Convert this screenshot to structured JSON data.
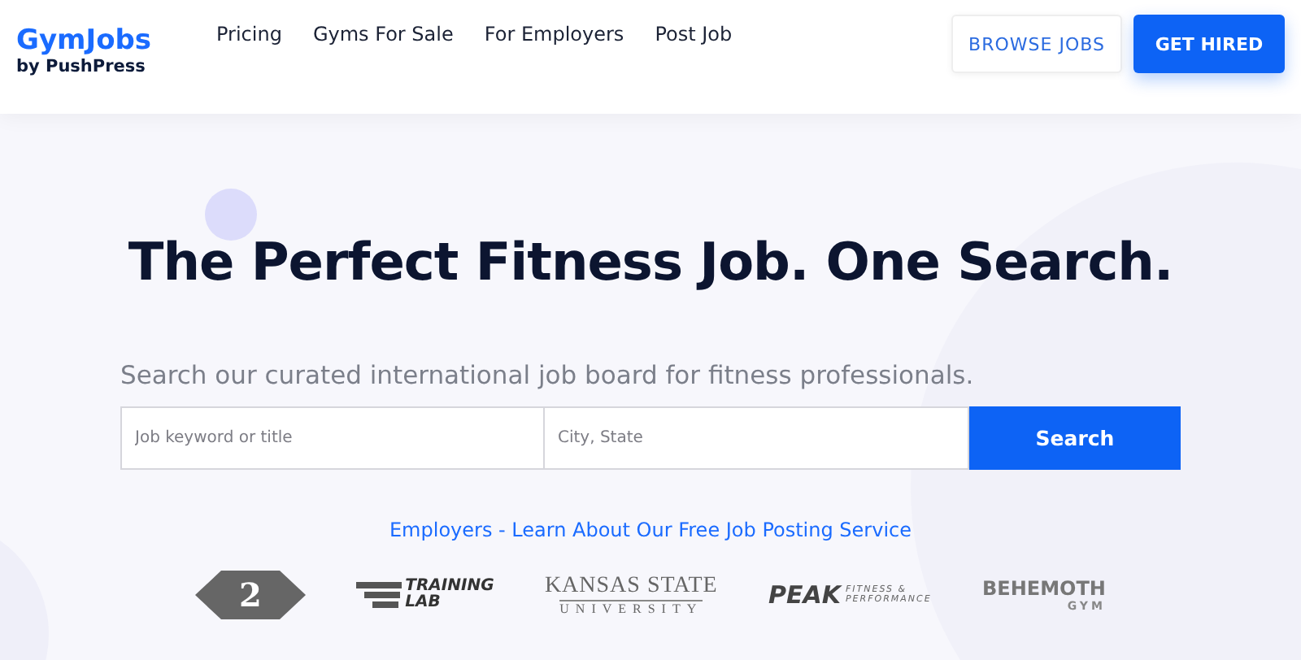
{
  "header": {
    "logo": {
      "name": "GymJobs",
      "byline": "by PushPress"
    },
    "nav": [
      "Pricing",
      "Gyms For Sale",
      "For Employers",
      "Post Job"
    ],
    "buttons": [
      {
        "label": "BROWSE JOBS",
        "kind": "outline"
      },
      {
        "label": "GET HIRED",
        "kind": "primary"
      }
    ]
  },
  "hero": {
    "title": "The Perfect Fitness Job. One Search.",
    "subtitle": "Search our curated international job board for fitness professionals.",
    "search": {
      "keyword_placeholder": "Job keyword or title",
      "location_placeholder": "City, State",
      "button": "Search"
    },
    "employer_link": "Employers - Learn About Our Free Job Posting Service"
  },
  "logos": [
    {
      "kind": "diamond",
      "lines": [
        "2"
      ]
    },
    {
      "kind": "wings",
      "lines": [
        "TRAINING",
        "LAB"
      ]
    },
    {
      "kind": "serif",
      "lines": [
        "KANSAS STATE",
        "UNIVERSITY"
      ]
    },
    {
      "kind": "peak",
      "lines": [
        "PEAK",
        "FITNESS &",
        "PERFORMANCE"
      ]
    },
    {
      "kind": "block",
      "lines": [
        "BEHEMOTH",
        "GYM"
      ]
    }
  ]
}
